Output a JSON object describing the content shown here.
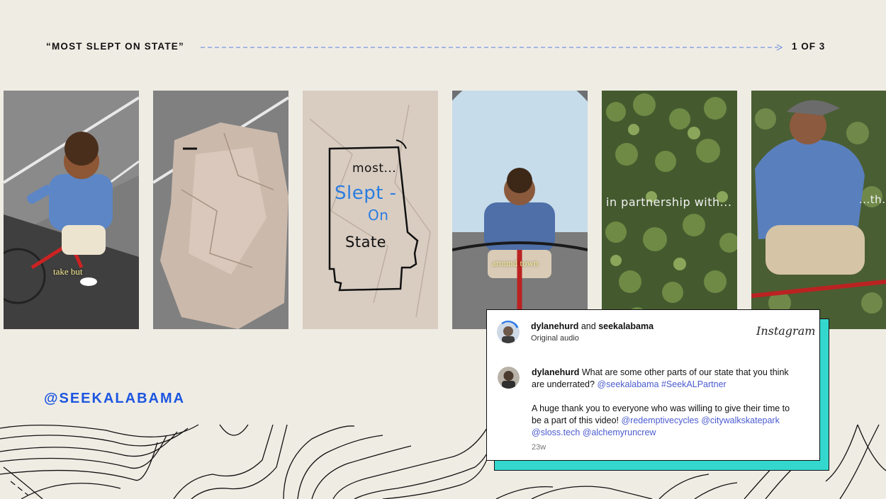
{
  "header": {
    "title": "“MOST SLEPT ON STATE”",
    "page_indicator": "1 OF 3"
  },
  "frames": [
    {
      "caption": "take but"
    },
    {
      "caption": ""
    },
    {
      "drawing_text": {
        "line1": "most...",
        "line2": "Slept -",
        "line3": "On",
        "line4": "State"
      }
    },
    {
      "caption": "around town"
    },
    {
      "overlay_text": "in partnership with..."
    },
    {
      "overlay_text": "...th..."
    }
  ],
  "handle": "@SEEKALABAMA",
  "post": {
    "author1": "dylanehurd",
    "joiner": " and ",
    "author2": "seekalabama",
    "audio": "Original audio",
    "platform": "Instagram",
    "comment_user": "dylanehurd",
    "comment_text": " What are some other parts of our state that you think are underrated? ",
    "comment_tag": "@seekalabama",
    "comment_hashtag": " #SeekALPartner",
    "thanks_text": "A huge thank you to everyone who was willing to give their time to be a part of this video! ",
    "mentions": "@redemptivecycles @citywalkskatepark @sloss.tech @alchemyruncrew",
    "time_ago": "23w"
  },
  "colors": {
    "background": "#efece4",
    "accent_blue": "#1c56e0",
    "card_shadow": "#34d7cd",
    "link": "#4a5bd0"
  }
}
